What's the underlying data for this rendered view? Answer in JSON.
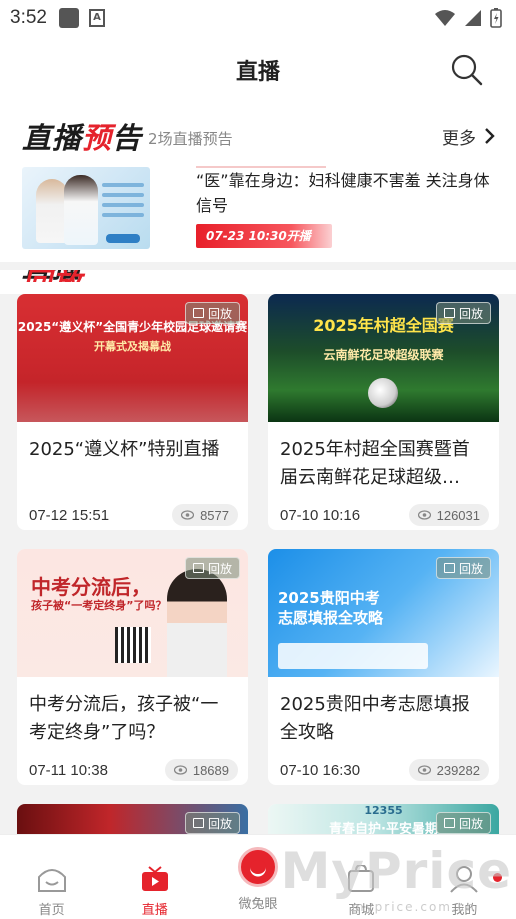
{
  "status_bar": {
    "time": "3:52"
  },
  "header": {
    "title": "直播"
  },
  "preview": {
    "logo_black": "直播",
    "logo_red": "预",
    "logo_black2": "告",
    "count": "2场直播预告",
    "more": "更多",
    "item": {
      "title": "“医”靠在身边：妇科健康不害羞 关注身体信号",
      "badge": "07-23 10:30开播"
    }
  },
  "replay": {
    "logo_black": "直播",
    "logo_red": "回放"
  },
  "cards": [
    {
      "title": "2025“遵义杯”特别直播",
      "date": "07-12 15:51",
      "views": "8577",
      "badge": "回放",
      "thumb_caption": "2025“遵义杯”全国青少年校园足球邀请赛",
      "thumb_sub": "开幕式及揭幕战"
    },
    {
      "title": "2025年村超全国赛暨首届云南鲜花足球超级…",
      "date": "07-10 10:16",
      "views": "126031",
      "badge": "回放",
      "thumb_caption": "2025年村超全国赛",
      "thumb_sub": "云南鲜花足球超级联赛"
    },
    {
      "title": "中考分流后，孩子被“一考定终身”了吗？",
      "date": "07-11 10:38",
      "views": "18689",
      "badge": "回放",
      "thumb_caption": "中考分流后，",
      "thumb_sub": "孩子被“一考定终身”了吗？"
    },
    {
      "title": "2025贵阳中考志愿填报全攻略",
      "date": "07-10 16:30",
      "views": "239282",
      "badge": "回放",
      "thumb_caption": "2025贵阳中考",
      "thumb_sub": "志愿填报全攻略"
    },
    {
      "title": "",
      "date": "",
      "views": "",
      "badge": "回放",
      "thumb_caption": "",
      "thumb_sub": ""
    },
    {
      "title": "",
      "date": "",
      "views": "",
      "badge": "回放",
      "thumb_caption": "青春自护·平安暑期",
      "thumb_sub": "12355"
    }
  ],
  "bottom_nav": {
    "items": [
      {
        "label": "首页"
      },
      {
        "label": "直播"
      },
      {
        "label": "微兔眼"
      },
      {
        "label": "商城"
      },
      {
        "label": "我的"
      }
    ]
  },
  "watermark": {
    "main": "MyPrice",
    "sub": "myprice.com.cn"
  },
  "colors": {
    "accent": "#e5232c",
    "background": "#f2f2f2"
  }
}
